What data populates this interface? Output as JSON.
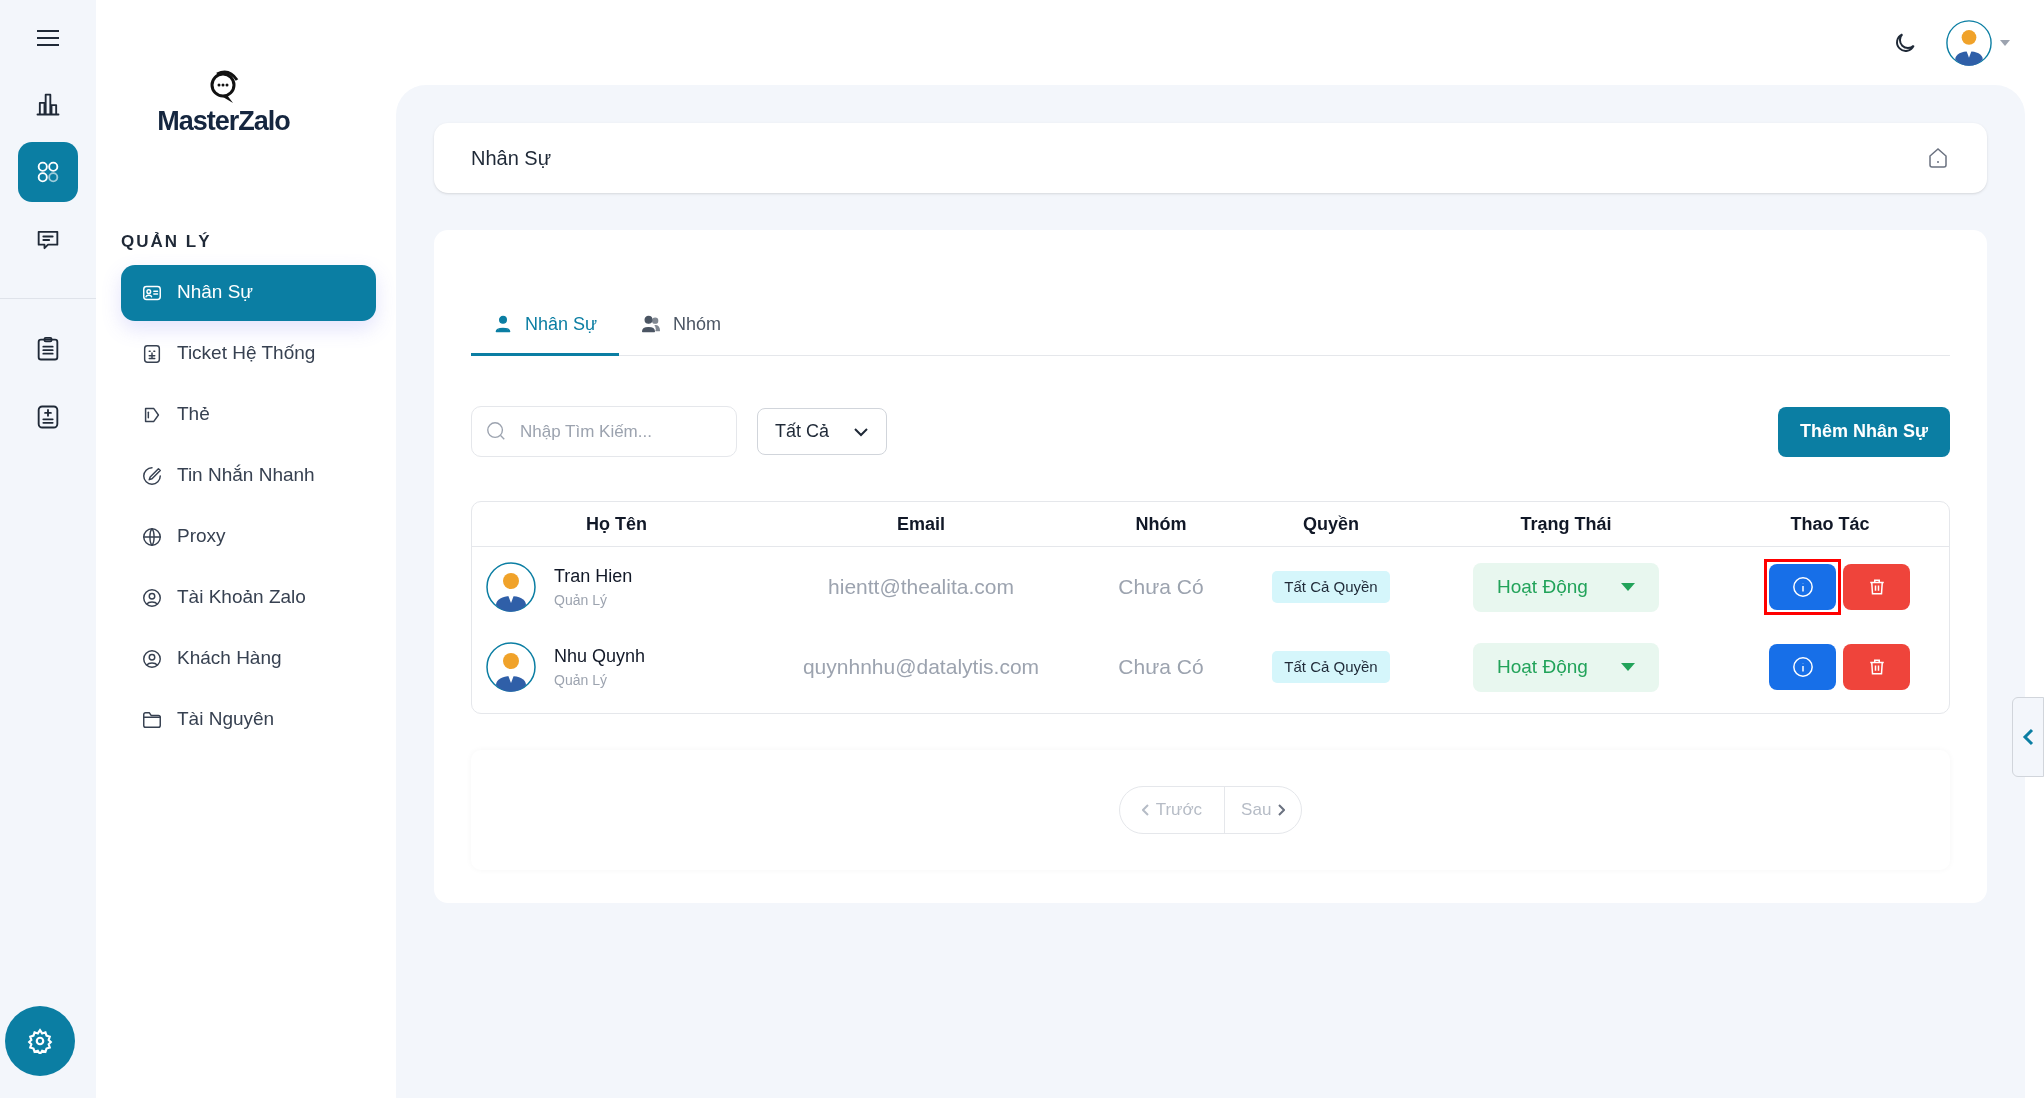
{
  "logo": {
    "text": "MasterZalo"
  },
  "rail": [
    {
      "kind": "chart",
      "selected": false
    },
    {
      "kind": "apps",
      "selected": true
    },
    {
      "kind": "chat",
      "selected": false
    },
    {
      "kind": "clipboard",
      "selected": false
    },
    {
      "kind": "calc",
      "selected": false
    }
  ],
  "sidebar": {
    "heading": "QUẢN LÝ",
    "items": [
      {
        "label": "Nhân Sự",
        "kind": "idcard",
        "selected": true
      },
      {
        "label": "Ticket Hệ Thống",
        "kind": "ticket",
        "selected": false
      },
      {
        "label": "Thẻ",
        "kind": "tag",
        "selected": false
      },
      {
        "label": "Tin Nhắn Nhanh",
        "kind": "pen",
        "selected": false
      },
      {
        "label": "Proxy",
        "kind": "globe",
        "selected": false
      },
      {
        "label": "Tài Khoản Zalo",
        "kind": "user",
        "selected": false
      },
      {
        "label": "Khách Hàng",
        "kind": "user",
        "selected": false
      },
      {
        "label": "Tài Nguyên",
        "kind": "folder",
        "selected": false
      }
    ]
  },
  "page_title": "Nhân Sự",
  "tabs": [
    {
      "label": "Nhân Sự",
      "kind": "person",
      "selected": true
    },
    {
      "label": "Nhóm",
      "kind": "people",
      "selected": false
    }
  ],
  "search": {
    "placeholder": "Nhập Tìm Kiếm..."
  },
  "filter": {
    "value": "Tất Cả"
  },
  "add_button": "Thêm Nhân Sự",
  "table": {
    "columns": [
      "Họ Tên",
      "Email",
      "Nhóm",
      "Quyền",
      "Trạng Thái",
      "Thao Tác"
    ],
    "rows": [
      {
        "name": "Tran Hien",
        "role": "Quản Lý",
        "email": "hientt@thealita.com",
        "group": "Chưa Có",
        "permission": "Tất Cả Quyền",
        "status": "Hoạt Động",
        "highlighted": true
      },
      {
        "name": "Nhu Quynh",
        "role": "Quản Lý",
        "email": "quynhnhu@datalytis.com",
        "group": "Chưa Có",
        "permission": "Tất Cả Quyền",
        "status": "Hoạt Động",
        "highlighted": false
      }
    ]
  },
  "pagination": {
    "prev": "Trước",
    "next": "Sau",
    "prev_disabled": true,
    "next_disabled": true
  }
}
